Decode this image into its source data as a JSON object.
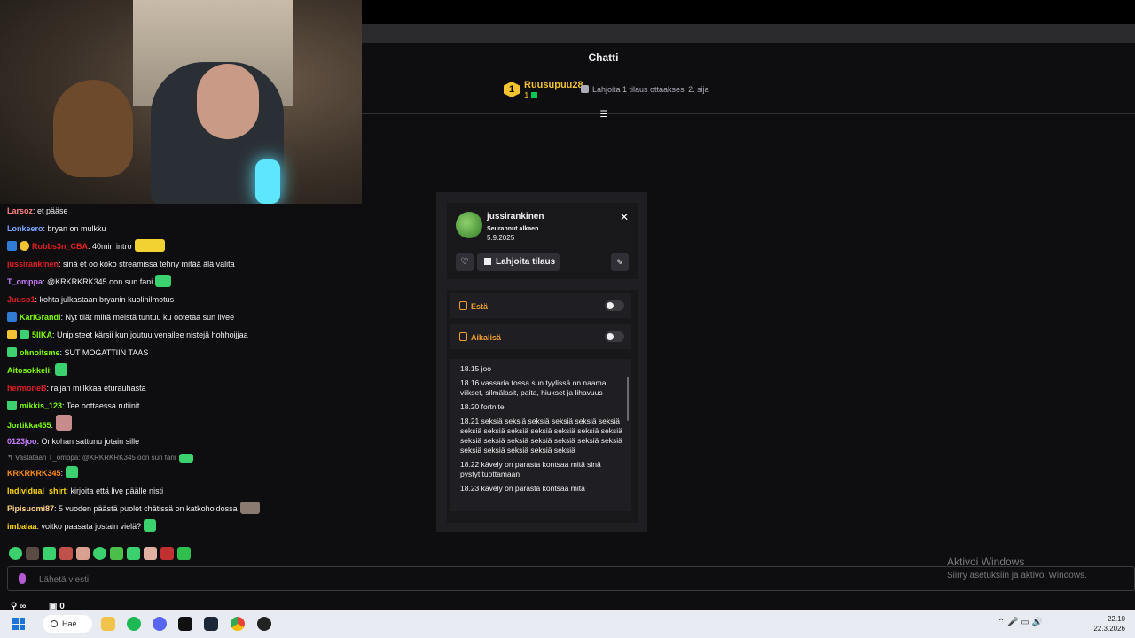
{
  "chat_panel": {
    "title": "Chatti",
    "leaderboard": {
      "rank": "1",
      "user": "Ruusupuu28",
      "count": "1",
      "hint": "Lahjoita 1 tilaus ottaaksesi 2. sija"
    },
    "messages": [
      {
        "user": "Larsoz",
        "color": "#ff7f7f",
        "text": ": et pääse"
      },
      {
        "user": "Lonkeero",
        "color": "#7aa7ff",
        "text": ": bryan on mulkku"
      },
      {
        "user": "Robbs3n_CBA",
        "color": "#e02020",
        "text": ": 40min intro"
      },
      {
        "user": "jussirankinen",
        "color": "#e02020",
        "text": ": sinä et oo koko streamissa tehny mitää älä valita"
      },
      {
        "user": "T_omppa",
        "color": "#c77dff",
        "text": ": @KRKRKRK345 oon sun fani"
      },
      {
        "user": "Juuso1",
        "color": "#e02020",
        "text": ": kohta julkastaan bryanin kuolinilmotus"
      },
      {
        "user": "KariGrandi",
        "color": "#7cfc00",
        "text": ": Nyt tiiät miltä meistä tuntuu ku ootetaa sun livee"
      },
      {
        "user": "5IIKA",
        "color": "#7cfc00",
        "text": ": Unipisteet kärsii kun joutuu venailee nistejä hohhoijjaa"
      },
      {
        "user": "ohnoitsme",
        "color": "#7cfc00",
        "text": ": SUT MOGATTIIN TAAS"
      },
      {
        "user": "Aitosokkeli",
        "color": "#7cfc00",
        "text": ":"
      },
      {
        "user": "hermoneB",
        "color": "#e02020",
        "text": ": raijan miilkkaa eturauhasta"
      },
      {
        "user": "mikkis_123",
        "color": "#7cfc00",
        "text": ": Tee oottaessa rutiinit"
      },
      {
        "user": "Jortikka455",
        "color": "#7cfc00",
        "text": ":"
      },
      {
        "user": "0123joo",
        "color": "#c77dff",
        "text": ": Onkohan sattunu jotain sille"
      },
      {
        "reply": "Vastataan T_omppa: @KRKRKRK345 oon sun fani"
      },
      {
        "user": "KRKRKRK345",
        "color": "#ff8c1a",
        "text": ":"
      },
      {
        "user": "Individual_shirt",
        "color": "#ffd700",
        "text": ": kirjoita että live päälle nisti"
      },
      {
        "user": "Pipisuomi87",
        "color": "#ffd27f",
        "text": ": 5 vuoden päästä puolet chätissä on katkohoidossa"
      },
      {
        "user": "imbalaa",
        "color": "#ffd700",
        "text": ": voitko paasata jostain vielä?"
      }
    ],
    "input_placeholder": "Lähetä viesti",
    "footer_left": "∞",
    "footer_right": "0"
  },
  "user_card": {
    "username": "jussirankinen",
    "follow_label": "Seurannut alkaen",
    "follow_date": "5.9.2025",
    "gift_label": "Lahjoita tilaus",
    "block_label": "Estä",
    "timeout_label": "Aikalisä",
    "close_symbol": "✕",
    "heart_symbol": "♡",
    "more_symbol": "✎",
    "log": [
      "18.15 joo",
      "18.16 vassaria tossa sun tyylissä on naama, viikset, silmälasit, paita, hiukset ja lihavuus",
      "18.20 fortnite",
      "18.21 seksiä seksiä seksiä seksiä seksiä seksiä seksiä seksiä seksiä seksiä seksiä seksiä seksiä seksiä seksiä seksiä seksiä seksiä seksiä seksiä seksiä seksiä seksiä seksiä seksiä",
      "18.22 kävely on parasta kontsaa mitä sinä pystyt tuottamaan",
      "18.23 kävely on parasta kontsaa mitä"
    ]
  },
  "windows": {
    "activate_title": "Aktivoi Windows",
    "activate_sub": "Siirry asetuksiin ja aktivoi Windows.",
    "search_label": "Hae",
    "time": "22.10",
    "date": "22.3.2026"
  }
}
